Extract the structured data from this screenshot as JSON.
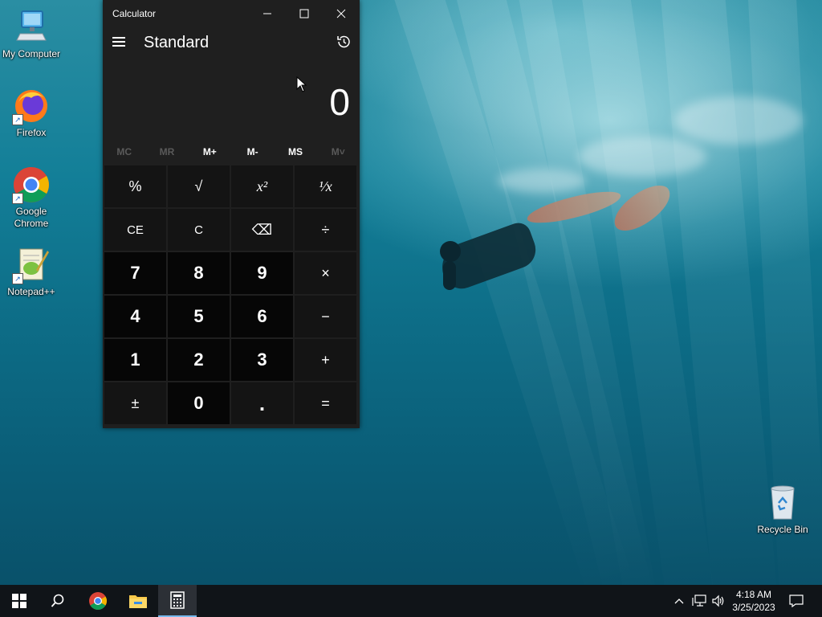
{
  "desktop": {
    "icons": [
      {
        "label": "My Computer"
      },
      {
        "label": "Firefox"
      },
      {
        "label": "Google Chrome"
      },
      {
        "label": "Notepad++"
      },
      {
        "label": "Recycle Bin"
      }
    ]
  },
  "calculator": {
    "window_title": "Calculator",
    "mode": "Standard",
    "display_value": "0",
    "memory_buttons": [
      {
        "label": "MC",
        "enabled": false
      },
      {
        "label": "MR",
        "enabled": false
      },
      {
        "label": "M+",
        "enabled": true
      },
      {
        "label": "M-",
        "enabled": true
      },
      {
        "label": "MS",
        "enabled": true
      },
      {
        "label": "M˅",
        "enabled": false
      }
    ],
    "keys": [
      {
        "label": "%",
        "name": "percent-key"
      },
      {
        "label": "√",
        "name": "square-root-key"
      },
      {
        "label": "x²",
        "name": "square-key"
      },
      {
        "label": "¹⁄x",
        "name": "reciprocal-key"
      },
      {
        "label": "CE",
        "name": "clear-entry-key"
      },
      {
        "label": "C",
        "name": "clear-key"
      },
      {
        "label": "⌫",
        "name": "backspace-key"
      },
      {
        "label": "÷",
        "name": "divide-key"
      },
      {
        "label": "7",
        "name": "digit-7-key"
      },
      {
        "label": "8",
        "name": "digit-8-key"
      },
      {
        "label": "9",
        "name": "digit-9-key"
      },
      {
        "label": "×",
        "name": "multiply-key"
      },
      {
        "label": "4",
        "name": "digit-4-key"
      },
      {
        "label": "5",
        "name": "digit-5-key"
      },
      {
        "label": "6",
        "name": "digit-6-key"
      },
      {
        "label": "−",
        "name": "subtract-key"
      },
      {
        "label": "1",
        "name": "digit-1-key"
      },
      {
        "label": "2",
        "name": "digit-2-key"
      },
      {
        "label": "3",
        "name": "digit-3-key"
      },
      {
        "label": "+",
        "name": "add-key"
      },
      {
        "label": "±",
        "name": "negate-key"
      },
      {
        "label": "0",
        "name": "digit-0-key"
      },
      {
        "label": ".",
        "name": "decimal-key"
      },
      {
        "label": "=",
        "name": "equals-key"
      }
    ]
  },
  "taskbar": {
    "clock_time": "4:18 AM",
    "clock_date": "3/25/2023",
    "apps": [
      "start-icon",
      "search-icon",
      "chrome-icon",
      "file-explorer-icon",
      "calculator-icon"
    ]
  },
  "colors": {
    "accent": "#76b9ed",
    "calc_bg": "#1f1f1f",
    "digit_key": "#060606",
    "op_key": "#141414"
  }
}
